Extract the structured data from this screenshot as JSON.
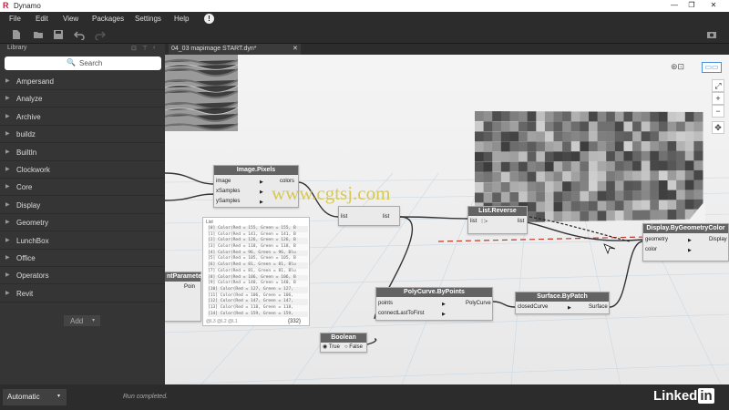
{
  "window": {
    "title": "Dynamo",
    "app_icon": "R"
  },
  "menu": [
    "File",
    "Edit",
    "View",
    "Packages",
    "Settings",
    "Help"
  ],
  "library": {
    "title": "Library",
    "search_placeholder": "Search",
    "items": [
      "Ampersand",
      "Analyze",
      "Archive",
      "buildz",
      "BuiltIn",
      "Clockwork",
      "Core",
      "Display",
      "Geometry",
      "LunchBox",
      "Office",
      "Operators",
      "Revit"
    ],
    "add_label": "Add"
  },
  "tab": {
    "label": "04_03 mapimage START.dyn*"
  },
  "nodes": {
    "image_pixels": {
      "title": "Image.Pixels",
      "inputs": [
        "image",
        "xSamples",
        "ySamples"
      ],
      "output": "colors"
    },
    "list_reverse": {
      "title": "List.Reverse",
      "input": "list",
      "output": "list"
    },
    "display": {
      "title": "Display.ByGeometryColor",
      "inputs": [
        "geometry",
        "color"
      ],
      "output": "Display"
    },
    "polycurve": {
      "title": "PolyCurve.ByPoints",
      "inputs": [
        "points",
        "connectLastToFirst"
      ],
      "output": "PolyCurve"
    },
    "surface": {
      "title": "Surface.ByPatch",
      "input": "closedCurve",
      "output": "Surface"
    },
    "boolean": {
      "title": "Boolean",
      "true_label": "True",
      "false_label": "False"
    },
    "partial_param": {
      "title": "ntParameter",
      "output": "Poin"
    },
    "flatten": {
      "input": "list",
      "output": "list"
    }
  },
  "preview": {
    "header": "List",
    "rows": [
      "[0] Color(Red = 155, Green = 155, B",
      "[1] Color(Red = 141, Green = 141, B",
      "[2] Color(Red = 126, Green = 126, B",
      "[3] Color(Red = 118, Green = 118, B",
      "[4] Color(Red = 96, Green = 96, Blu",
      "[5] Color(Red = 105, Green = 105, B",
      "[6] Color(Red = 81, Green = 81, Blu",
      "[7] Color(Red = 81, Green = 81, Blu",
      "[8] Color(Red = 106, Green = 106, B",
      "[9] Color(Red = 140, Green = 140, B",
      "[10] Color(Red = 127, Green = 127,",
      "[11] Color(Red = 106, Green = 106,",
      "[12] Color(Red = 147, Green = 147,",
      "[13] Color(Red = 118, Green = 118,",
      "[14] Color(Red = 159, Green = 159,"
    ],
    "footer": "@L3 @L2 @L1",
    "count": "{332}"
  },
  "status": {
    "run_mode": "Automatic",
    "message": "Run completed."
  },
  "watermark": "www.cgtsj.com",
  "brand": {
    "text": "Linked",
    "suffix": "in"
  },
  "colors": {
    "node_header": "#636363",
    "canvas_bg": "#f2f2f2",
    "sidebar_bg": "#353535"
  }
}
